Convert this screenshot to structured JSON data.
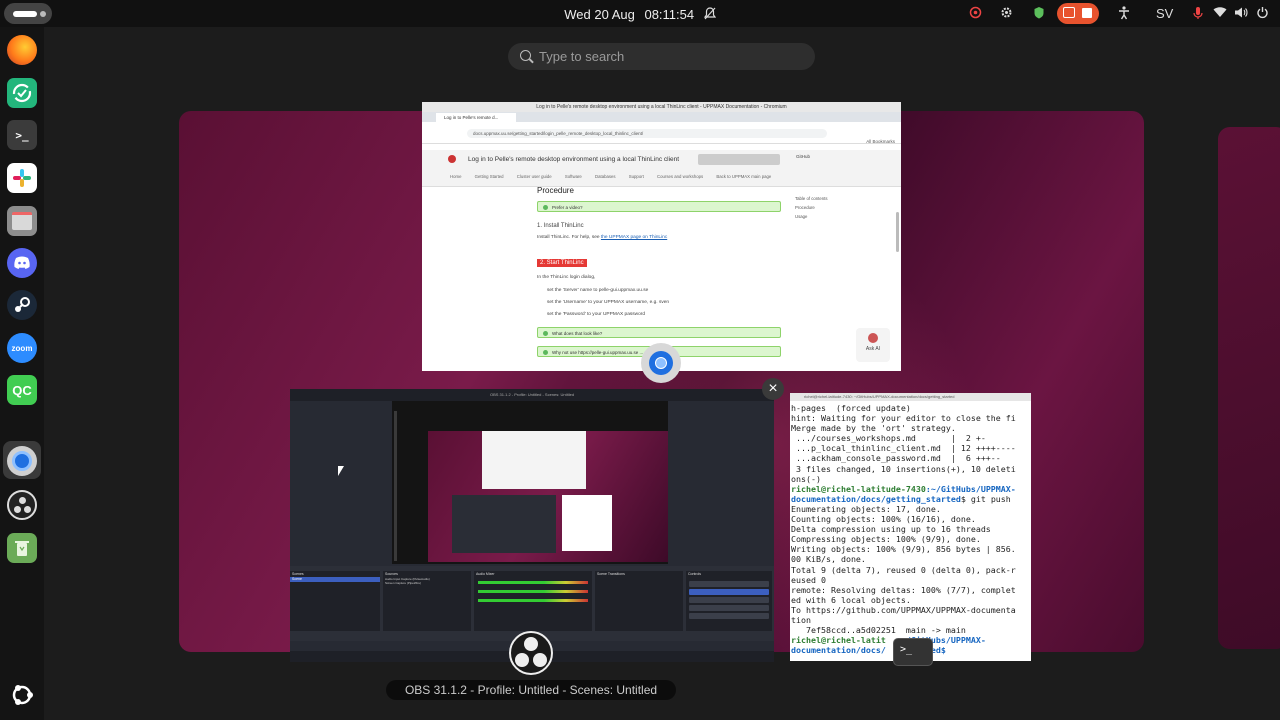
{
  "topbar": {
    "clock": {
      "day": "Wed 20 Aug",
      "time": "08:11:54"
    },
    "keyboard_layout": "SV",
    "icons": [
      "notifications-off-icon",
      "network-cloud-icon",
      "cog-icon",
      "shield-icon",
      "screen-record-icon",
      "stop-record-icon",
      "accessibility-icon",
      "microphone-icon",
      "wifi-icon",
      "volume-icon",
      "power-icon"
    ],
    "record_color": "#e8532e"
  },
  "dock": {
    "apps": [
      {
        "name": "firefox",
        "label": "",
        "color": "#ff7a1a"
      },
      {
        "name": "software-updater",
        "label": "",
        "color": "#23b67c"
      },
      {
        "name": "terminal",
        "label": ">_",
        "color": "#3b3b3b"
      },
      {
        "name": "slack",
        "label": "",
        "color": "#ffffff"
      },
      {
        "name": "files",
        "label": "",
        "color": "#8d8d8d"
      },
      {
        "name": "discord",
        "label": "",
        "color": "#5865f2"
      },
      {
        "name": "steam",
        "label": "",
        "color": "#1b2838"
      },
      {
        "name": "zoom",
        "label": "zoom",
        "color": "#2d8cff"
      },
      {
        "name": "qtcreator",
        "label": "QC",
        "color": "#41cd52"
      },
      {
        "name": "chromium",
        "label": "",
        "color": "#1f6fe0"
      },
      {
        "name": "obs",
        "label": "",
        "color": "#222222"
      },
      {
        "name": "trash",
        "label": "",
        "color": "#6bab58"
      }
    ],
    "show_apps_icon": "ubuntu-icon"
  },
  "search": {
    "placeholder": "Type to search"
  },
  "browser": {
    "window_title": "Log in to Pelle's remote desktop environment using a local ThinLinc client - UPPMAX Documentation - Chromium",
    "tab_title": "Log in to Pelle's remote d...",
    "url": "docs.uppmax.uu.se/getting_started/login_pelle_remote_desktop_local_thinlinc_client/",
    "bookmarks": "All Bookmarks",
    "site_title": "Log in to Pelle's remote desktop environment using a local ThinLinc client",
    "github": "GitHub",
    "nav": [
      "Home",
      "Getting Started",
      "Cluster user guide",
      "Software",
      "Databases",
      "Support",
      "Courses and workshops",
      "Back to UPPMAX main page"
    ],
    "heading": "Procedure",
    "admon1": "Prefer a video?",
    "step1": "1. Install ThinLinc",
    "step1_text_prefix": "Install ThinLinc. For help, see ",
    "step1_link": "the UPPMAX page on ThinLinc",
    "step2": "2. Start ThinLinc",
    "step2_text": "In the ThinLinc login dialog,",
    "bullets": [
      "set the 'Server' name to pelle-gui.uppmax.uu.se",
      "set the 'Username' to your UPPMAX username, e.g. sven",
      "set the 'Password' to your UPPMAX password"
    ],
    "admon2": "What does that look like?",
    "admon3": "Why not use https://pelle-gui.uppmax.uu.se ...",
    "toc": [
      "Table of contents",
      "Procedure",
      "Usage"
    ],
    "ask_ai": "Ask AI"
  },
  "obs": {
    "caption": "OBS 31.1.2 - Profile: Untitled - Scenes: Untitled",
    "title": "OBS 31.1.2 - Profile: Untitled - Scenes: Untitled",
    "menu": [
      "File",
      "Edit",
      "View",
      "Docks",
      "Profile",
      "Scene Collection",
      "Tools",
      "Help"
    ],
    "panels": [
      "Scenes",
      "Sources",
      "Audio Mixer",
      "Scene Transitions",
      "Controls"
    ],
    "scene": "Scene",
    "sources": [
      "Audio Input Capture (PulseAudio)",
      "Screen Capture (PipeWire)"
    ],
    "controls": [
      "Start Streaming",
      "Stop Recording",
      "Start Virtual Camera",
      "Studio Mode",
      "Settings",
      "Exit"
    ]
  },
  "terminal": {
    "title": "richel@richel-latitude-7430: ~/GitHubs/UPPMAX-documentation/docs/getting_started",
    "lines": [
      "h-pages  (forced update)",
      "hint: Waiting for your editor to close the fi",
      "Merge made by the 'ort' strategy.",
      " .../courses_workshops.md       |  2 +-",
      " ...p_local_thinlinc_client.md  | 12 ++++----",
      " ...ackham_console_password.md  |  6 +++--",
      " 3 files changed, 10 insertions(+), 10 deleti",
      "ons(-)"
    ],
    "prompt1": "richel@richel-latitude-7430",
    "path1a": ":~/GitHubs/UPPMAX-",
    "path1b": "documentation/docs/getting_started",
    "cmd1": "$ git push",
    "lines2": [
      "Enumerating objects: 17, done.",
      "Counting objects: 100% (16/16), done.",
      "Delta compression using up to 16 threads",
      "Compressing objects: 100% (9/9), done.",
      "Writing objects: 100% (9/9), 856 bytes | 856.",
      "00 KiB/s, done.",
      "Total 9 (delta 7), reused 0 (delta 0), pack-r",
      "eused 0",
      "remote: Resolving deltas: 100% (7/7), complet",
      "ed with 6 local objects.",
      "To https://github.com/UPPMAX/UPPMAX-documenta",
      "tion",
      "   7ef58ccd..a5d02251  main -> main"
    ],
    "prompt2": "richel@richel-latit",
    "path2a": "  :~/GitHubs/UPPMAX-",
    "path2b": "documentation/docs/",
    "path2c": "    started$ "
  }
}
